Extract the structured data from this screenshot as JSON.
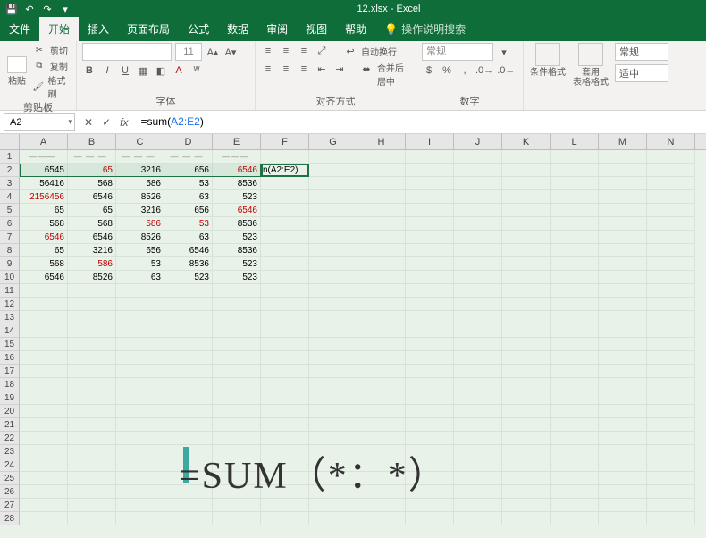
{
  "title": "12.xlsx - Excel",
  "qat": {
    "save": "💾",
    "undo": "↶",
    "redo": "↷"
  },
  "tabs": {
    "file": "文件",
    "home": "开始",
    "insert": "插入",
    "layout": "页面布局",
    "formulas": "公式",
    "data": "数据",
    "review": "审阅",
    "view": "视图",
    "help": "帮助",
    "tell": "操作说明搜索"
  },
  "ribbon": {
    "clipboard": {
      "paste": "粘贴",
      "cut": "剪切",
      "copy": "复制",
      "fmtpaint": "格式刷",
      "title": "剪贴板"
    },
    "font": {
      "title": "字体",
      "size": "11",
      "bold": "B",
      "italic": "I",
      "underline": "U"
    },
    "align": {
      "title": "对齐方式",
      "wrap": "自动换行",
      "merge": "合并后居中"
    },
    "number": {
      "title": "数字",
      "general": "常规"
    },
    "styles": {
      "cond": "条件格式",
      "table": "套用\n表格格式",
      "normal": "常规",
      "good": "适中"
    }
  },
  "namebox": "A2",
  "formula": {
    "pre": "=sum(",
    "range": "A2:E2",
    "post": ")"
  },
  "columns": [
    "A",
    "B",
    "C",
    "D",
    "E",
    "F",
    "G",
    "H",
    "I",
    "J",
    "K",
    "L",
    "M",
    "N"
  ],
  "rows": [
    1,
    2,
    3,
    4,
    5,
    6,
    7,
    8,
    9,
    10,
    11,
    12,
    13,
    14,
    15,
    16,
    17,
    18,
    19,
    20,
    21,
    22,
    23,
    24,
    25,
    26,
    27,
    28
  ],
  "data": {
    "r1": [
      "——— ",
      "— — —",
      "— — —",
      "— — —",
      "———"
    ],
    "r2": [
      {
        "v": "6545"
      },
      {
        "v": "65",
        "r": 1
      },
      {
        "v": "3216"
      },
      {
        "v": "656"
      },
      {
        "v": "6546",
        "r": 1
      }
    ],
    "r3": [
      {
        "v": "56416"
      },
      {
        "v": "568"
      },
      {
        "v": "586"
      },
      {
        "v": "53"
      },
      {
        "v": "8536"
      }
    ],
    "r4": [
      {
        "v": "2156456",
        "r": 1
      },
      {
        "v": "6546"
      },
      {
        "v": "8526"
      },
      {
        "v": "63"
      },
      {
        "v": "523"
      }
    ],
    "r5": [
      {
        "v": "65"
      },
      {
        "v": "65"
      },
      {
        "v": "3216"
      },
      {
        "v": "656"
      },
      {
        "v": "6546",
        "r": 1
      }
    ],
    "r6": [
      {
        "v": "568"
      },
      {
        "v": "568"
      },
      {
        "v": "586",
        "r": 1
      },
      {
        "v": "53",
        "r": 1
      },
      {
        "v": "8536"
      }
    ],
    "r7": [
      {
        "v": "6546",
        "r": 1
      },
      {
        "v": "6546"
      },
      {
        "v": "8526"
      },
      {
        "v": "63"
      },
      {
        "v": "523"
      }
    ],
    "r8": [
      {
        "v": "65"
      },
      {
        "v": "3216"
      },
      {
        "v": "656"
      },
      {
        "v": "6546"
      },
      {
        "v": "8536"
      }
    ],
    "r9": [
      {
        "v": "568"
      },
      {
        "v": "586",
        "r": 1
      },
      {
        "v": "53"
      },
      {
        "v": "8536"
      },
      {
        "v": "523"
      }
    ],
    "r10": [
      {
        "v": "6546"
      },
      {
        "v": "8526"
      },
      {
        "v": "63"
      },
      {
        "v": "523"
      },
      {
        "v": "523"
      }
    ]
  },
  "f2": "n(A2:E2)",
  "watermark": "=SUM（*：*）"
}
